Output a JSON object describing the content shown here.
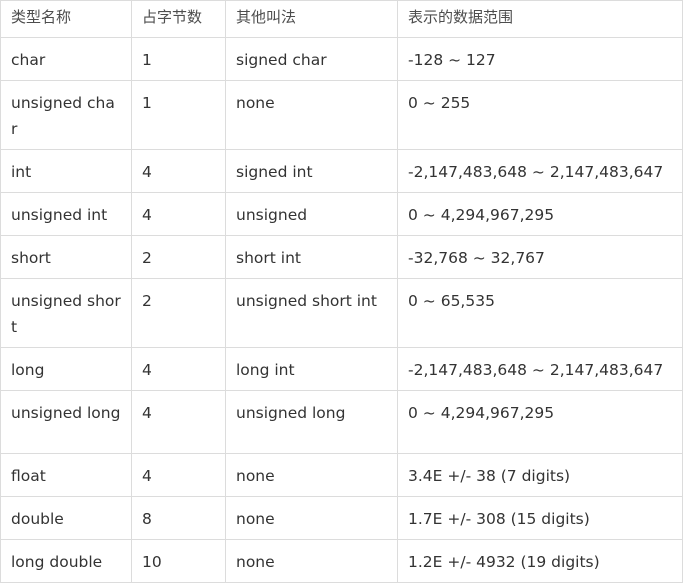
{
  "table": {
    "headers": [
      "类型名称",
      "占字节数",
      "其他叫法",
      "表示的数据范围"
    ],
    "rows": [
      [
        "char",
        "1",
        "signed char",
        "-128 ~ 127"
      ],
      [
        "unsigned char",
        "1",
        "none",
        "0 ~ 255"
      ],
      [
        "int",
        "4",
        "signed int",
        "-2,147,483,648 ~ 2,147,483,647"
      ],
      [
        "unsigned int",
        "4",
        "unsigned",
        "0 ~ 4,294,967,295"
      ],
      [
        "short",
        "2",
        "short int",
        "-32,768 ~ 32,767"
      ],
      [
        "unsigned short",
        "2",
        "unsigned short int",
        "0 ~ 65,535"
      ],
      [
        "long",
        "4",
        "long int",
        "-2,147,483,648 ~ 2,147,483,647"
      ],
      [
        "unsigned long",
        "4",
        "unsigned long",
        "0 ~ 4,294,967,295"
      ],
      [
        "float",
        "4",
        "none",
        "3.4E +/- 38 (7 digits)"
      ],
      [
        "double",
        "8",
        "none",
        "1.7E +/- 308 (15 digits)"
      ],
      [
        "long double",
        "10",
        "none",
        "1.2E +/- 4932 (19 digits)"
      ]
    ]
  }
}
